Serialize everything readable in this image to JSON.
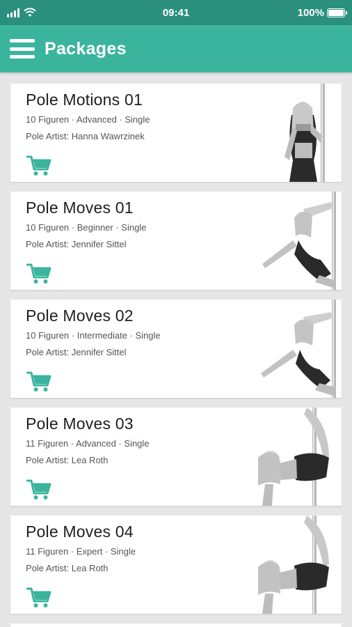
{
  "status_bar": {
    "time": "09:41",
    "battery_text": "100%",
    "battery_level": 1.0,
    "icons": [
      "signal-icon",
      "wifi-icon",
      "battery-icon"
    ]
  },
  "app_bar": {
    "title": "Packages",
    "background": "#3bb49e",
    "menu_icon": "hamburger-menu-icon"
  },
  "accent_color": "#3bb49e",
  "packages": [
    {
      "title": "Pole Motions 01",
      "meta": "10 Figuren · Advanced · Single",
      "artist": "Pole Artist: Hanna Wawrzinek",
      "cart_icon": "shopping-cart-icon"
    },
    {
      "title": "Pole Moves 01",
      "meta": "10 Figuren · Beginner · Single",
      "artist": "Pole Artist: Jennifer Sittel",
      "cart_icon": "shopping-cart-icon"
    },
    {
      "title": "Pole Moves 02",
      "meta": "10 Figuren · Intermediate · Single",
      "artist": "Pole Artist: Jennifer Sittel",
      "cart_icon": "shopping-cart-icon"
    },
    {
      "title": "Pole Moves 03",
      "meta": "11 Figuren · Advanced · Single",
      "artist": "Pole Artist: Lea Roth",
      "cart_icon": "shopping-cart-icon"
    },
    {
      "title": "Pole Moves 04",
      "meta": "11 Figuren · Expert · Single",
      "artist": "Pole Artist: Lea Roth",
      "cart_icon": "shopping-cart-icon"
    }
  ]
}
